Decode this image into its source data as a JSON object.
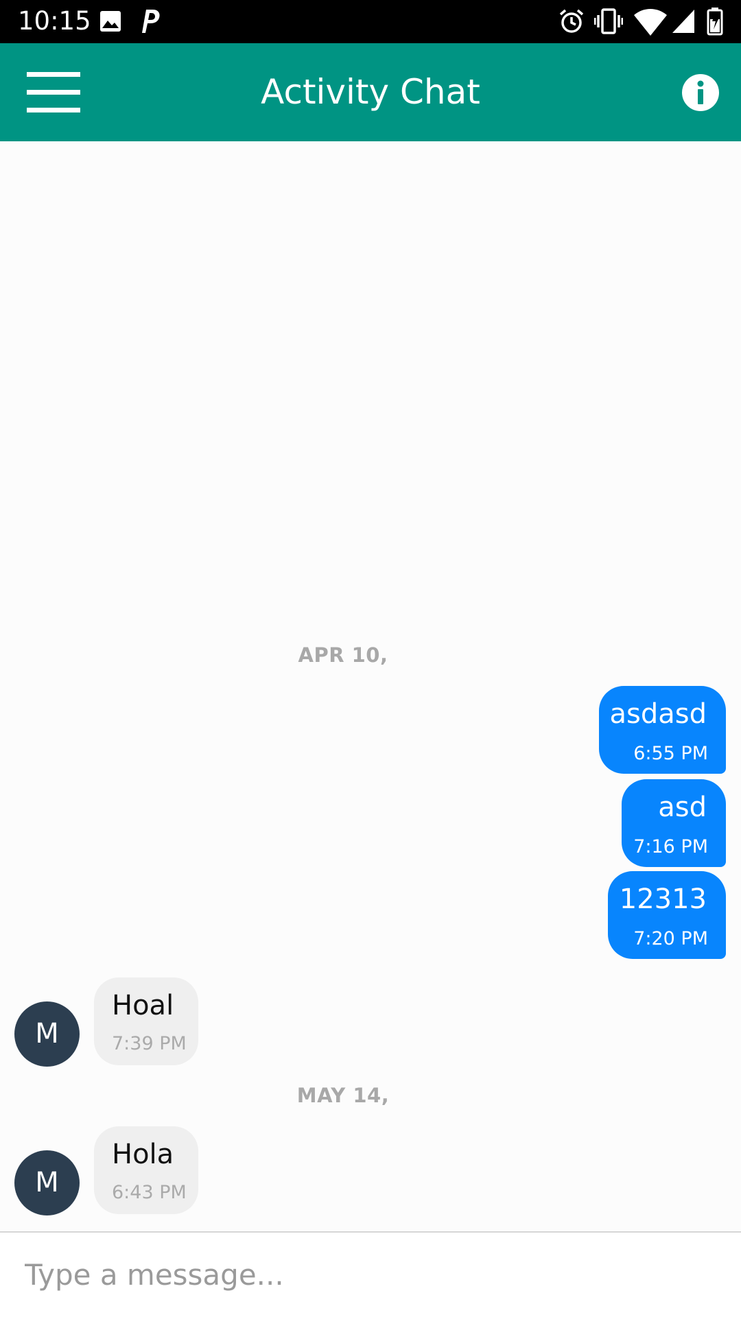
{
  "status_bar": {
    "time": "10:15",
    "icons": [
      "image-icon",
      "parking-icon",
      "alarm-icon",
      "vibrate-icon",
      "wifi-icon",
      "signal-icon",
      "battery-icon"
    ]
  },
  "app_bar": {
    "title": "Activity Chat",
    "menu_icon": "hamburger-menu-icon",
    "info_icon": "info-icon",
    "color": "#009483"
  },
  "chat": {
    "date_separators": [
      "APR 10,",
      "MAY 14,"
    ],
    "messages": [
      {
        "direction": "outgoing",
        "text": "asdasd",
        "time": "6:55 PM"
      },
      {
        "direction": "outgoing",
        "text": "asd",
        "time": "7:16 PM"
      },
      {
        "direction": "outgoing",
        "text": "12313",
        "time": "7:20 PM"
      },
      {
        "direction": "incoming",
        "sender_initial": "M",
        "text": "Hoal",
        "time": "7:39 PM"
      },
      {
        "direction": "incoming",
        "sender_initial": "M",
        "text": "Hola",
        "time": "6:43 PM"
      }
    ],
    "outgoing_color": "#0885fd",
    "incoming_color": "#efefef",
    "avatar_color": "#2c3e50"
  },
  "composer": {
    "placeholder": "Type a message...",
    "value": ""
  }
}
